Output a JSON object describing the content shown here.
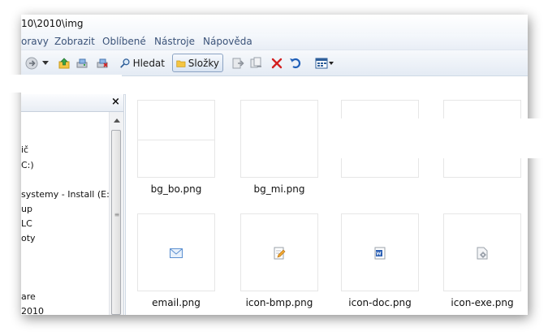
{
  "window": {
    "path": "10\\2010\\img"
  },
  "menu": [
    "oravy",
    "Zobrazit",
    "Oblíbené",
    "Nástroje",
    "Nápověda"
  ],
  "toolbar": {
    "search_label": "Hledat",
    "folders_label": "Složky"
  },
  "left_pane": {
    "close_glyph": "×",
    "tree_items": [
      "ič",
      "C:)",
      "systemy - Install (E:)",
      "up",
      "LC",
      "oty",
      "are",
      "2010"
    ]
  },
  "files": [
    {
      "name": "bg_bo.png",
      "icon": "blank-thumbnail"
    },
    {
      "name": "bg_mi.png",
      "icon": "blank-thumbnail"
    },
    {
      "name": "",
      "icon": "hidden"
    },
    {
      "name": "",
      "icon": "hidden"
    },
    {
      "name": "email.png",
      "icon": "envelope-icon"
    },
    {
      "name": "icon-bmp.png",
      "icon": "pencil-page-icon"
    },
    {
      "name": "icon-doc.png",
      "icon": "word-doc-icon"
    },
    {
      "name": "icon-exe.png",
      "icon": "gear-page-icon"
    }
  ],
  "colors": {
    "menu_text": "#3b5379",
    "toolbar_bg": "#e4ebf4",
    "delete_red": "#d32020",
    "undo_blue": "#1f5fb8",
    "folder_yellow": "#f4c542"
  }
}
